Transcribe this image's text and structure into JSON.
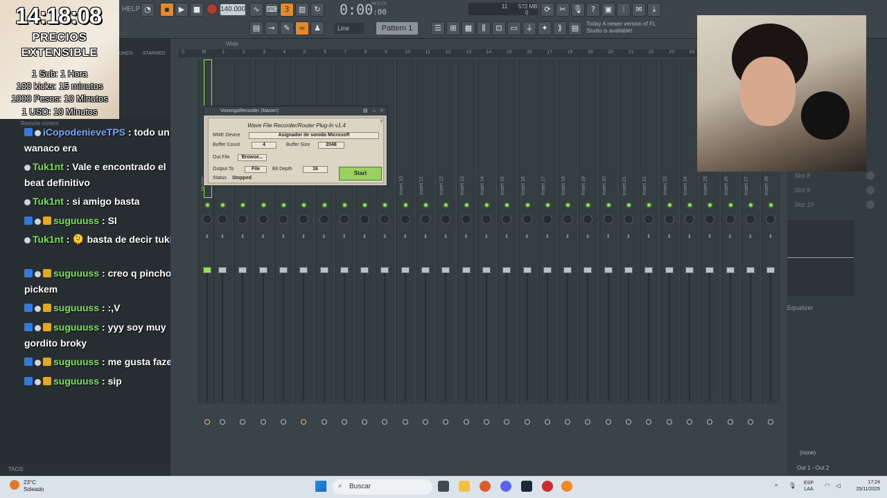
{
  "toolbar": {
    "help_label": "HELP",
    "tempo": "140.000",
    "timecode_main": "0:00",
    "timecode_sub": ":00",
    "timecode_unit": "M:S:CS",
    "cpu": "11",
    "memory": "572 MB",
    "voices": "0",
    "line_mode": "Line",
    "pattern": "Pattern 1",
    "news_date": "Today",
    "news_text": "A newer version of FL Studio is available!"
  },
  "overlay": {
    "timer": "14:18:08",
    "prices_title_1": "PRECIOS",
    "prices_title_2": "EXTENSIBLE",
    "prices": [
      "1 Sub: 1 Hora",
      "100 kicks: 15 minutos",
      "1000 Pesos: 10 Minutos",
      "1 USD: 10 Minutos"
    ]
  },
  "browser": {
    "tab_sounds": "UNDS",
    "tab_starred": "STARRED",
    "remote_control": "Remote control",
    "tags": "TAGS"
  },
  "chat": [
    {
      "user": "iCopodenieveTPS",
      "text": " : todo un wanaco era",
      "color": "blue"
    },
    {
      "user": "Tuk1nt",
      "text": " : Vale e encontrado el beat definitivo",
      "color": "green"
    },
    {
      "user": "Tuk1nt",
      "text": " : si amigo basta",
      "color": "green"
    },
    {
      "user": "suguuuss",
      "text": " : SI",
      "color": "green"
    },
    {
      "user": "Tuk1nt",
      "text": " : 🫠 basta de decir tuki",
      "color": "green"
    },
    {
      "user": "suguuuss",
      "text": " : creo q pincho pickem",
      "color": "green"
    },
    {
      "user": "suguuuss",
      "text": " : :,V",
      "color": "green"
    },
    {
      "user": "suguuuss",
      "text": " : yyy soy muy gordito broky",
      "color": "green"
    },
    {
      "user": "suguuuss",
      "text": " : me gusta faze",
      "color": "green"
    },
    {
      "user": "suguuuss",
      "text": " : sip",
      "color": "green"
    }
  ],
  "mixer": {
    "title": "Wide",
    "ruler": [
      "C",
      "M",
      "1",
      "2",
      "3",
      "4",
      "5",
      "6",
      "7",
      "8",
      "9",
      "10",
      "11",
      "12",
      "13",
      "14",
      "15",
      "16",
      "17",
      "18",
      "19",
      "20",
      "21",
      "22",
      "23",
      "24"
    ],
    "strip_labels": [
      "Master",
      "Inse",
      "Inse",
      "Inse",
      "Inse",
      "Inse",
      "Inse",
      "Inse",
      "Inse",
      "Inse",
      "Insert 10",
      "Insert 11",
      "Insert 12",
      "Insert 13",
      "Insert 14",
      "Insert 15",
      "Insert 16",
      "Insert 17",
      "Insert 18",
      "Insert 19",
      "Insert 20",
      "Insert 21",
      "Insert 22",
      "Insert 23",
      "Insert 24",
      "Insert 25",
      "Insert 26",
      "Insert 27",
      "Insert 28"
    ]
  },
  "plugin": {
    "window_title": "VoxengoRecorder (Master)",
    "heading": "Wave File Recorder/Router Plug-In v1.4",
    "mme_label": "MME Device",
    "mme_value": "Asignador de sonido Microsoft",
    "buffer_count_label": "Buffer Count",
    "buffer_count_value": "4",
    "buffer_size_label": "Buffer Size",
    "buffer_size_value": "2048",
    "out_file_label": "Out File",
    "browse_label": "Browse...",
    "output_to_label": "Output To",
    "output_to_value": "File",
    "bit_depth_label": "Bit Depth",
    "bit_depth_value": "16",
    "status_label": "Status",
    "status_value": "Stopped",
    "start_label": "Start"
  },
  "right_panel": {
    "slots": [
      "Slot 8",
      "Slot 9",
      "Slot 10"
    ],
    "equalizer": "Equalizer",
    "none": "(none)",
    "output": "Out 1 - Out 2"
  },
  "taskbar": {
    "temperature": "23°C",
    "weather": "Soleado",
    "search": "Buscar",
    "lang_1": "ESP",
    "lang_2": "LAA",
    "time": "17:24",
    "date": "25/11/2025"
  }
}
